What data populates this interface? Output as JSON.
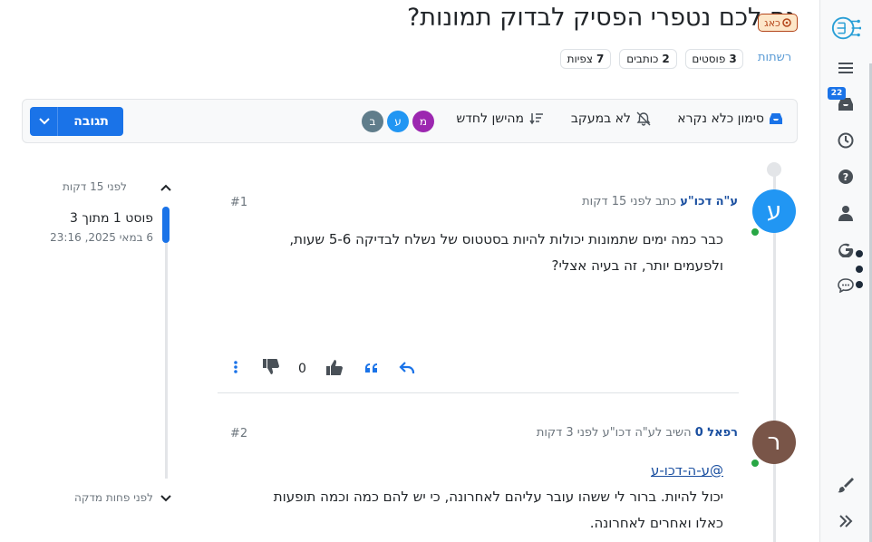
{
  "topic": {
    "title": "גם לכם נטפרי הפסיק לבדוק תמונות?",
    "category": {
      "label": "כאג",
      "color": "#b4451a",
      "bg": "#fde7c9"
    },
    "tag": "רשתות",
    "stats": [
      {
        "count": "3",
        "label": "פוסטים"
      },
      {
        "count": "2",
        "label": "כותבים"
      },
      {
        "count": "7",
        "label": "צפיות"
      }
    ]
  },
  "toolbar": {
    "mark_unread": "סימון כלא נקרא",
    "watch": "לא במעקב",
    "sort": "מהישן לחדש",
    "reply": "תגובה",
    "participants": [
      {
        "letter": "מ",
        "color": "#9c27b0"
      },
      {
        "letter": "ע",
        "color": "#2196f3"
      },
      {
        "letter": "ב",
        "color": "#607d8b"
      }
    ]
  },
  "timeline": {
    "top": "לפני 15 דקות",
    "position": "פוסט 1 מתוך 3",
    "date": "6 במאי 2025, 23:16",
    "bottom": "לפני פחות מדקה"
  },
  "posts": [
    {
      "avatar_letter": "ע",
      "avatar_color": "#2196f3",
      "author": "ע\"ה דכו\"ע",
      "meta": "כתב לפני 15 דקות",
      "index": "#1",
      "lines": [
        "כבר כמה ימים שתמונות יכולות להיות בסטטוס של נשלח לבדיקה 5-6 שעות,",
        "ולפעמים יותר, זה בעיה אצלי?"
      ],
      "votes": "0"
    },
    {
      "avatar_letter": "ר",
      "avatar_color": "#795548",
      "author": "רפאל 0",
      "meta": "השיב לע\"ה דכו\"ע לפני 3 דקות",
      "index": "#2",
      "mention": "@ע-ה-דכו-ע",
      "lines": [
        "יכול להיות. ברור לי ששהו עובר עליהם לאחרונה, כי יש להם כמה וכמה תופעות",
        "כאלו ואחרים לאחרונה."
      ]
    }
  ],
  "sidebar": {
    "notifications_count": "22"
  },
  "colors": {
    "accent": "#1a73e8",
    "online": "#28a745"
  }
}
